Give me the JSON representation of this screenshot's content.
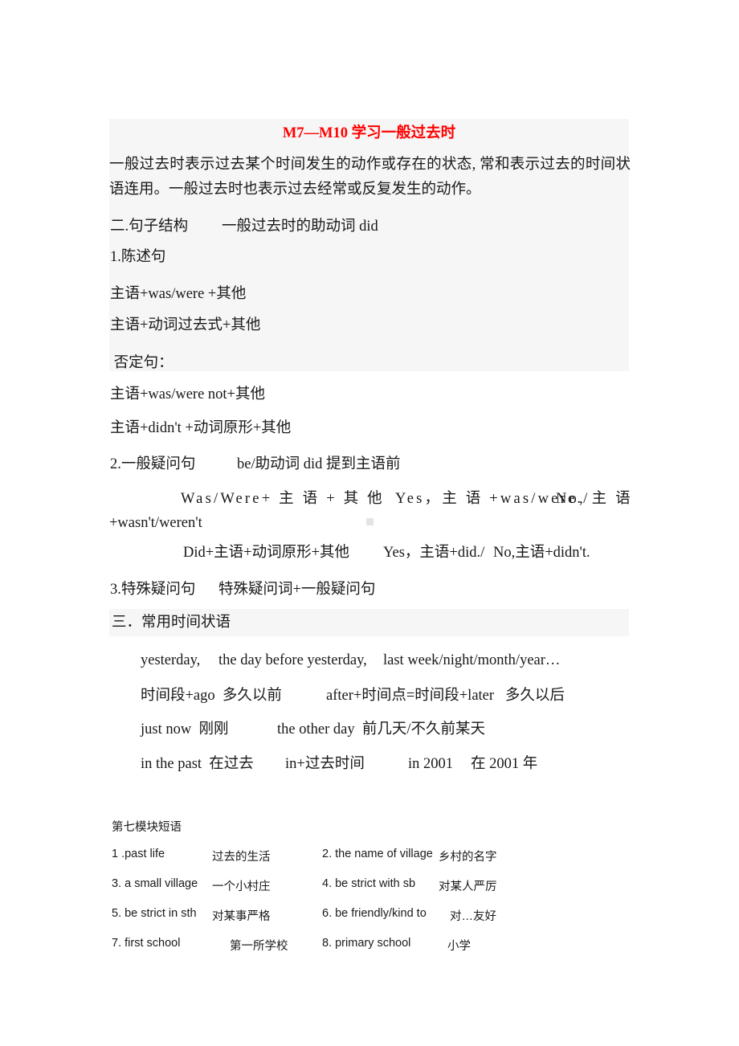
{
  "document": {
    "title": "M7—M10 学习一般过去时",
    "title_color": "#ff0000",
    "highlight_color": "#f6f6f6"
  },
  "intro": {
    "paragraph": "一般过去时表示过去某个时间发生的动作或存在的状态, 常和表示过去的时间状语连用。一般过去时也表示过去经常或反复发生的动作。"
  },
  "section_structure": {
    "heading": "二.句子结构",
    "heading_note": "一般过去时的助动词 did",
    "declarative": {
      "label": "1.陈述句",
      "patterns": [
        "主语+was/were +其他",
        "主语+动词过去式+其他"
      ]
    },
    "negative": {
      "label": " 否定句：",
      "patterns": [
        "主语+was/were not+其他",
        "主语+didn't +动词原形+其他"
      ]
    },
    "general_question": {
      "label": "2.一般疑问句",
      "note": "be/助动词 did 提到主语前",
      "be_pattern": "Was/Were+ 主 语 + 其 他",
      "be_answer_yes": "Yes，主 语 +was/were./",
      "be_answer_no_head": "No, 主 语",
      "be_answer_no_tail": "+wasn't/weren't",
      "did_pattern": "Did+主语+动词原形+其他",
      "did_answer_yes": "Yes，主语+did./",
      "did_answer_no": "No,主语+didn't."
    },
    "special_question": {
      "label": "3.特殊疑问句",
      "note": "特殊疑问词+一般疑问句"
    }
  },
  "section_time_adverbials": {
    "heading": "三．常用时间状语",
    "lines": [
      {
        "a": "yesterday,",
        "b": "the day before yesterday,",
        "c": "last week/night/month/year…"
      },
      {
        "a": "时间段+ago  多久以前",
        "b": "after+时间点=时间段+later   多久以后"
      },
      {
        "a": "just now  刚刚",
        "b": "the other day  前几天/不久前某天"
      },
      {
        "a": "in the past  在过去",
        "b": "in+过去时间",
        "c": "in 2001",
        "d": "在 2001 年"
      }
    ]
  },
  "section_phrases": {
    "heading": "第七模块短语",
    "rows": [
      {
        "num_left": "1 .past life",
        "cn_left": "过去的生活",
        "num_right": "2. the name of village",
        "cn_right": "乡村的名字"
      },
      {
        "num_left": "3. a small village",
        "cn_left": "一个小村庄",
        "num_right": "4. be strict with sb",
        "cn_right": "对某人严厉"
      },
      {
        "num_left": "5. be strict in sth",
        "cn_left": "对某事严格",
        "num_right": "6. be friendly/kind to",
        "cn_right": "对…友好"
      },
      {
        "num_left": "7. first school",
        "cn_left": "第一所学校",
        "num_right": "8. primary school",
        "cn_right": "小学"
      }
    ]
  }
}
